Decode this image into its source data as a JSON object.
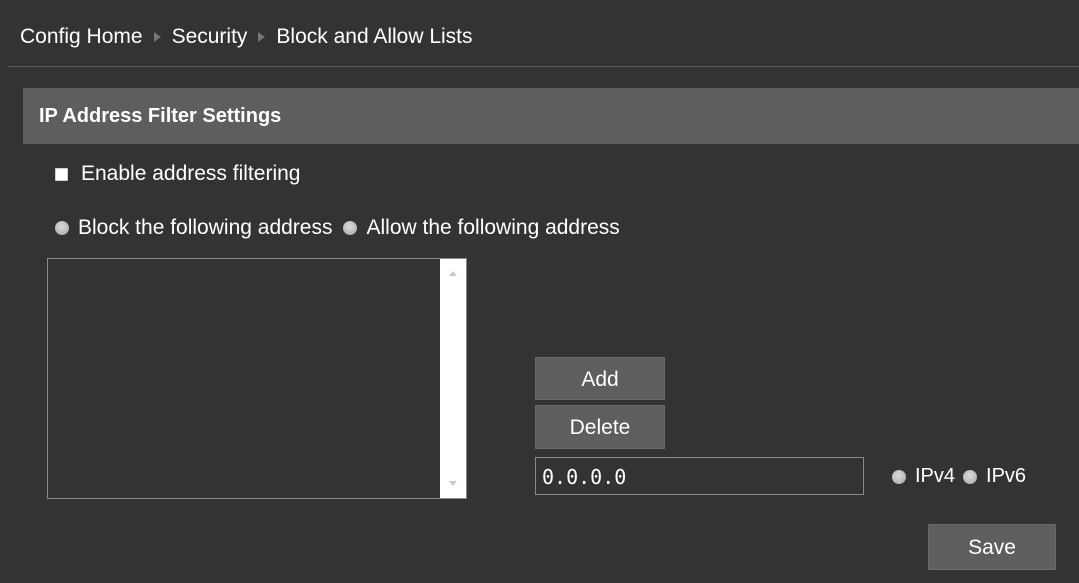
{
  "breadcrumb": {
    "items": [
      "Config Home",
      "Security",
      "Block and Allow Lists"
    ]
  },
  "section": {
    "title": "IP Address Filter Settings"
  },
  "filter": {
    "enable_label": "Enable address filtering",
    "enable_checked": false,
    "mode_options": [
      "Block the following address",
      "Allow the following address"
    ]
  },
  "address_list": {
    "items": []
  },
  "actions": {
    "add_label": "Add",
    "delete_label": "Delete"
  },
  "ip_entry": {
    "value": "0.0.0.0",
    "versions": [
      "IPv4",
      "IPv6"
    ]
  },
  "save_label": "Save",
  "colors": {
    "background": "#333333",
    "header": "#5e5e5e",
    "button": "#5e5e5e",
    "text": "#ffffff"
  },
  "icons": {
    "breadcrumb_separator": "triangle-right-icon",
    "scroll_up": "triangle-up-icon",
    "scroll_down": "triangle-down-icon"
  }
}
